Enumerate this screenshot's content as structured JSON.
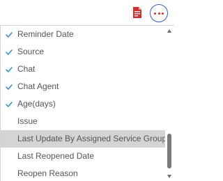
{
  "toolbar": {
    "pdf_icon": "pdf-file-icon",
    "more_icon": "more-options-icon",
    "pdf_color": "#d32f2f",
    "more_border_color": "#2f5fd0"
  },
  "menu": {
    "check_color": "#3a8fd0",
    "highlight_color": "#d4d4d4",
    "items": [
      {
        "label": "Reminder Date",
        "checked": true
      },
      {
        "label": "Source",
        "checked": true
      },
      {
        "label": "Chat",
        "checked": true
      },
      {
        "label": "Chat Agent",
        "checked": true
      },
      {
        "label": "Age(days)",
        "checked": true
      },
      {
        "label": "Issue",
        "checked": false
      },
      {
        "label": "Last Update By Assigned Service Group",
        "checked": false,
        "highlighted": true
      },
      {
        "label": "Last Reopened Date",
        "checked": false
      },
      {
        "label": "Reopen Reason",
        "checked": false
      }
    ]
  }
}
